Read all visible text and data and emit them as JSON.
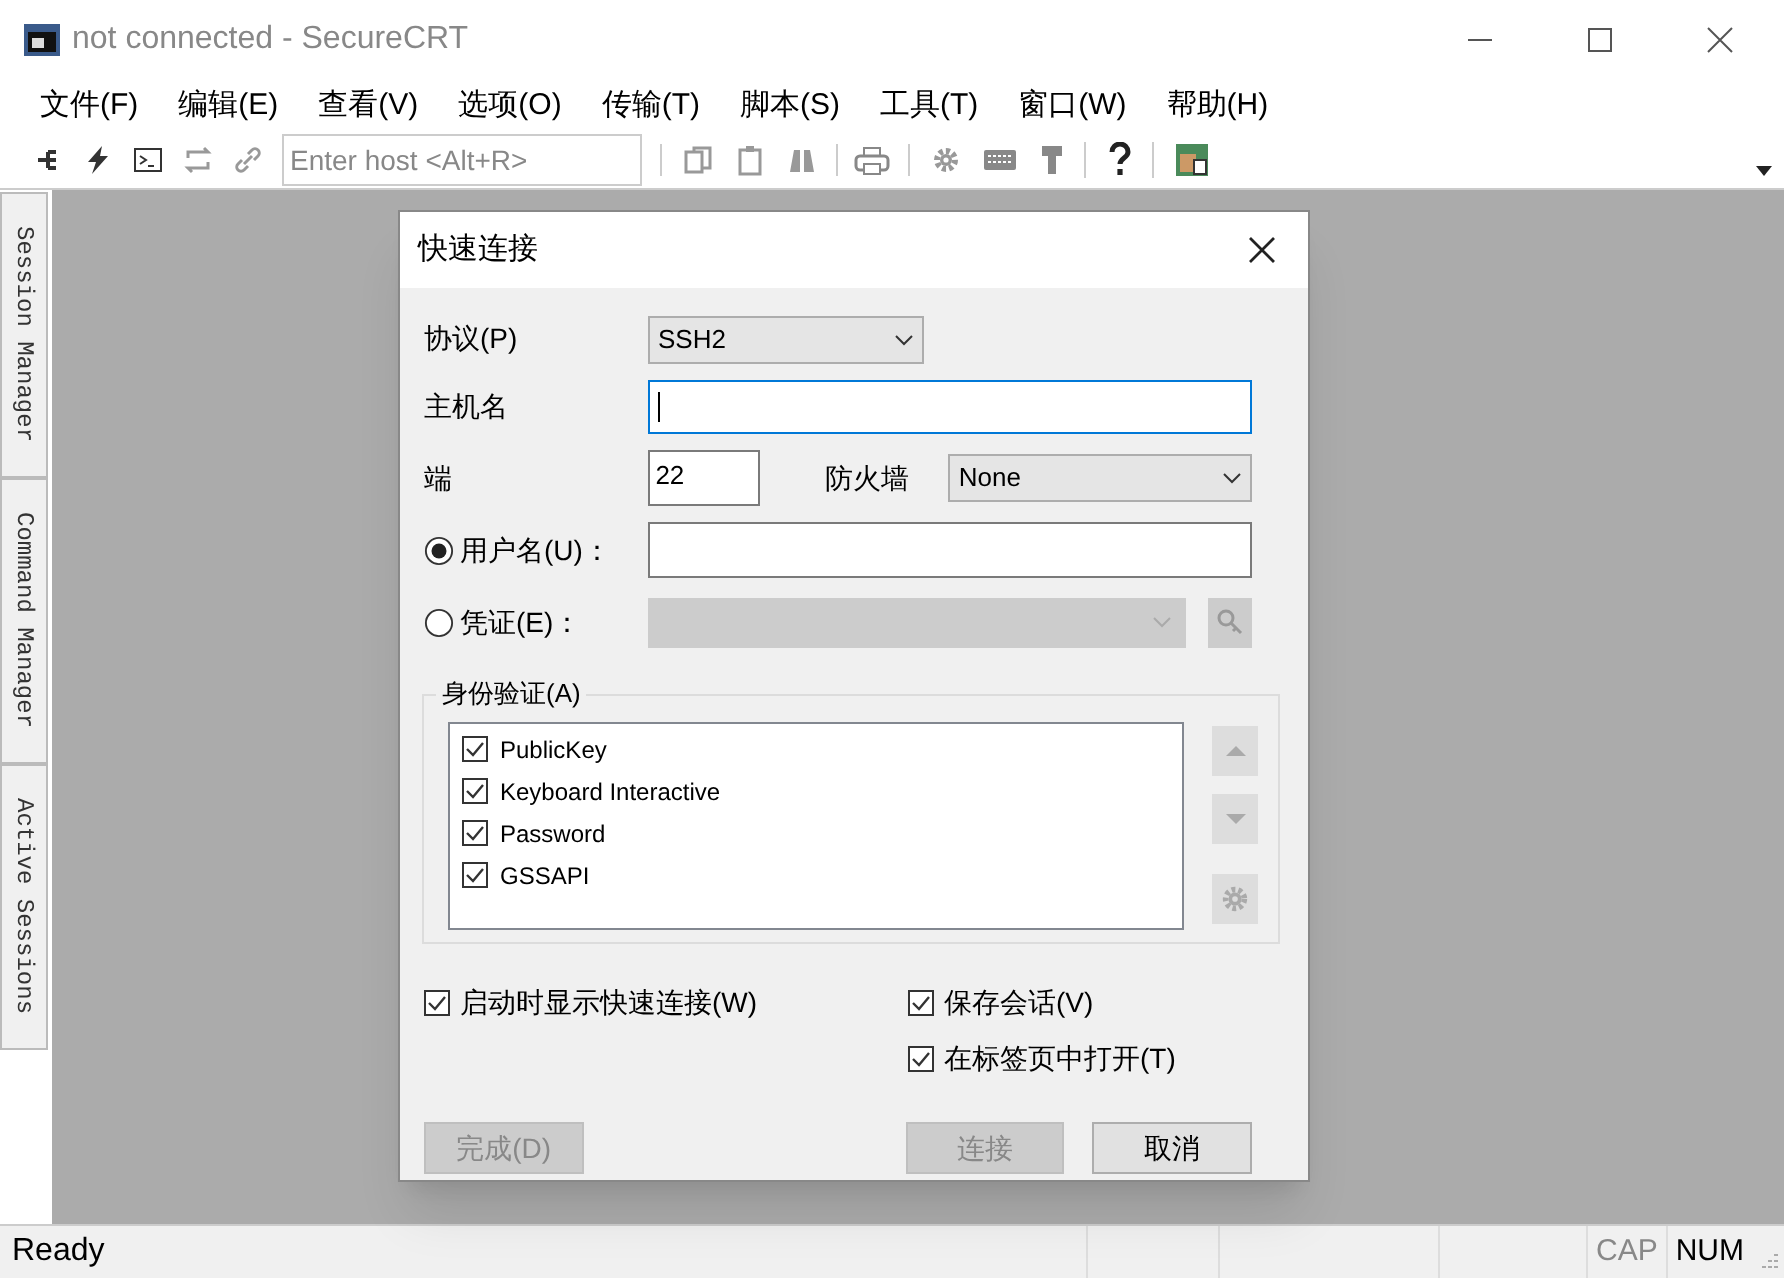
{
  "window": {
    "title": "not connected - SecureCRT"
  },
  "menu": [
    "文件(F)",
    "编辑(E)",
    "查看(V)",
    "选项(O)",
    "传输(T)",
    "脚本(S)",
    "工具(T)",
    "窗口(W)",
    "帮助(H)"
  ],
  "toolbar": {
    "host_placeholder": "Enter host <Alt+R>"
  },
  "side_tabs": [
    "Session Manager",
    "Command Manager",
    "Active Sessions"
  ],
  "dialog": {
    "title": "快速连接",
    "protocol": {
      "label": "协议(P)",
      "value": "SSH2"
    },
    "hostname": {
      "label": "主机名"
    },
    "port": {
      "label": "端",
      "value": "22"
    },
    "firewall": {
      "label": "防火墙",
      "value": "None"
    },
    "login": [
      {
        "label": "用户名(U)：",
        "selected": true,
        "kind": "text",
        "disabled": false
      },
      {
        "label": "凭证(E)：",
        "selected": false,
        "kind": "select",
        "disabled": true
      }
    ],
    "auth": {
      "label": "身份验证(A)",
      "methods": [
        {
          "name": "PublicKey",
          "checked": true
        },
        {
          "name": "Keyboard Interactive",
          "checked": true
        },
        {
          "name": "Password",
          "checked": true
        },
        {
          "name": "GSSAPI",
          "checked": true
        }
      ]
    },
    "options": [
      {
        "label": "启动时显示快速连接(W)",
        "checked": true
      },
      {
        "label": "保存会话(V)",
        "checked": true
      },
      {
        "label": "在标签页中打开(T)",
        "checked": true
      }
    ],
    "buttons": [
      {
        "label": "完成(D)",
        "disabled": true
      },
      {
        "label": "连接",
        "disabled": true
      },
      {
        "label": "取消",
        "disabled": false
      }
    ]
  },
  "status_bar": {
    "text": "Ready",
    "indicators": [
      {
        "label": "CAP",
        "on": false
      },
      {
        "label": "NUM",
        "on": true
      }
    ]
  }
}
